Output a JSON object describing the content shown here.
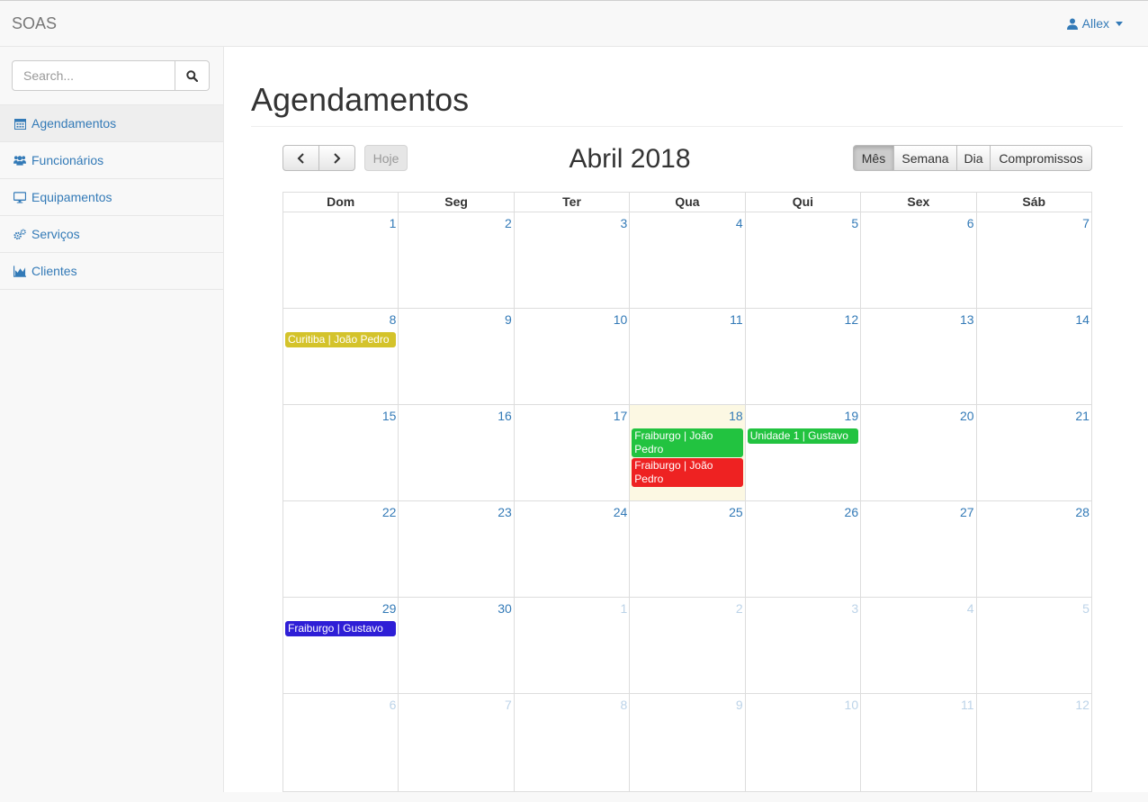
{
  "navbar": {
    "brand": "SOAS",
    "user": "Allex"
  },
  "sidebar": {
    "search_placeholder": "Search...",
    "items": [
      {
        "label": "Agendamentos",
        "icon": "calendar-icon",
        "active": true
      },
      {
        "label": "Funcionários",
        "icon": "users-icon",
        "active": false
      },
      {
        "label": "Equipamentos",
        "icon": "desktop-icon",
        "active": false
      },
      {
        "label": "Serviços",
        "icon": "cogs-icon",
        "active": false
      },
      {
        "label": "Clientes",
        "icon": "chart-area-icon",
        "active": false
      }
    ]
  },
  "main": {
    "title": "Agendamentos"
  },
  "calendar": {
    "title": "Abril 2018",
    "today_label": "Hoje",
    "views": [
      "Mês",
      "Semana",
      "Dia",
      "Compromissos"
    ],
    "active_view": "Mês",
    "weekdays": [
      "Dom",
      "Seg",
      "Ter",
      "Qua",
      "Qui",
      "Sex",
      "Sáb"
    ],
    "weeks": [
      [
        "1",
        "2",
        "3",
        "4",
        "5",
        "6",
        "7"
      ],
      [
        "8",
        "9",
        "10",
        "11",
        "12",
        "13",
        "14"
      ],
      [
        "15",
        "16",
        "17",
        "18",
        "19",
        "20",
        "21"
      ],
      [
        "22",
        "23",
        "24",
        "25",
        "26",
        "27",
        "28"
      ],
      [
        "29",
        "30",
        "1",
        "2",
        "3",
        "4",
        "5"
      ],
      [
        "6",
        "7",
        "8",
        "9",
        "10",
        "11",
        "12"
      ]
    ],
    "today": "18",
    "events": [
      {
        "title": "Curitiba | João Pedro",
        "day": "8",
        "color": "#d4c32b"
      },
      {
        "title": "Fraiburgo | João Pedro",
        "day": "18",
        "color": "#22c340"
      },
      {
        "title": "Fraiburgo | João Pedro",
        "day": "18",
        "color": "#ee2222"
      },
      {
        "title": "Unidade 1 | Gustavo",
        "day": "19",
        "color": "#22c340"
      },
      {
        "title": "Fraiburgo | Gustavo",
        "day": "29",
        "color": "#2e1ed6"
      }
    ]
  }
}
